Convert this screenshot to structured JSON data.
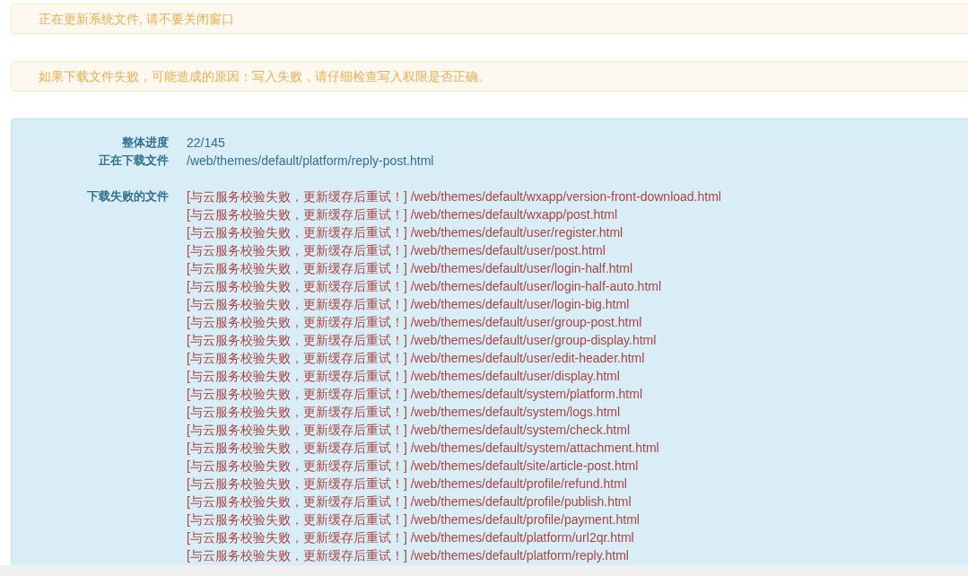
{
  "alerts": [
    "正在更新系统文件, 请不要关闭窗口",
    "如果下载文件失败，可能造成的原因：写入失败，请仔细检查写入权限是否正确。"
  ],
  "progress": {
    "overall_label": "整体进度",
    "overall_value": "22/145",
    "current_label": "正在下载文件",
    "current_value": "/web/themes/default/platform/reply-post.html",
    "failed_label": "下载失败的文件",
    "failed_files": [
      "[与云服务校验失败，更新缓存后重试！] /web/themes/default/wxapp/version-front-download.html",
      "[与云服务校验失败，更新缓存后重试！] /web/themes/default/wxapp/post.html",
      "[与云服务校验失败，更新缓存后重试！] /web/themes/default/user/register.html",
      "[与云服务校验失败，更新缓存后重试！] /web/themes/default/user/post.html",
      "[与云服务校验失败，更新缓存后重试！] /web/themes/default/user/login-half.html",
      "[与云服务校验失败，更新缓存后重试！] /web/themes/default/user/login-half-auto.html",
      "[与云服务校验失败，更新缓存后重试！] /web/themes/default/user/login-big.html",
      "[与云服务校验失败，更新缓存后重试！] /web/themes/default/user/group-post.html",
      "[与云服务校验失败，更新缓存后重试！] /web/themes/default/user/group-display.html",
      "[与云服务校验失败，更新缓存后重试！] /web/themes/default/user/edit-header.html",
      "[与云服务校验失败，更新缓存后重试！] /web/themes/default/user/display.html",
      "[与云服务校验失败，更新缓存后重试！] /web/themes/default/system/platform.html",
      "[与云服务校验失败，更新缓存后重试！] /web/themes/default/system/logs.html",
      "[与云服务校验失败，更新缓存后重试！] /web/themes/default/system/check.html",
      "[与云服务校验失败，更新缓存后重试！] /web/themes/default/system/attachment.html",
      "[与云服务校验失败，更新缓存后重试！] /web/themes/default/site/article-post.html",
      "[与云服务校验失败，更新缓存后重试！] /web/themes/default/profile/refund.html",
      "[与云服务校验失败，更新缓存后重试！] /web/themes/default/profile/publish.html",
      "[与云服务校验失败，更新缓存后重试！] /web/themes/default/profile/payment.html",
      "[与云服务校验失败，更新缓存后重试！] /web/themes/default/platform/url2qr.html",
      "[与云服务校验失败，更新缓存后重试！] /web/themes/default/platform/reply.html"
    ]
  }
}
